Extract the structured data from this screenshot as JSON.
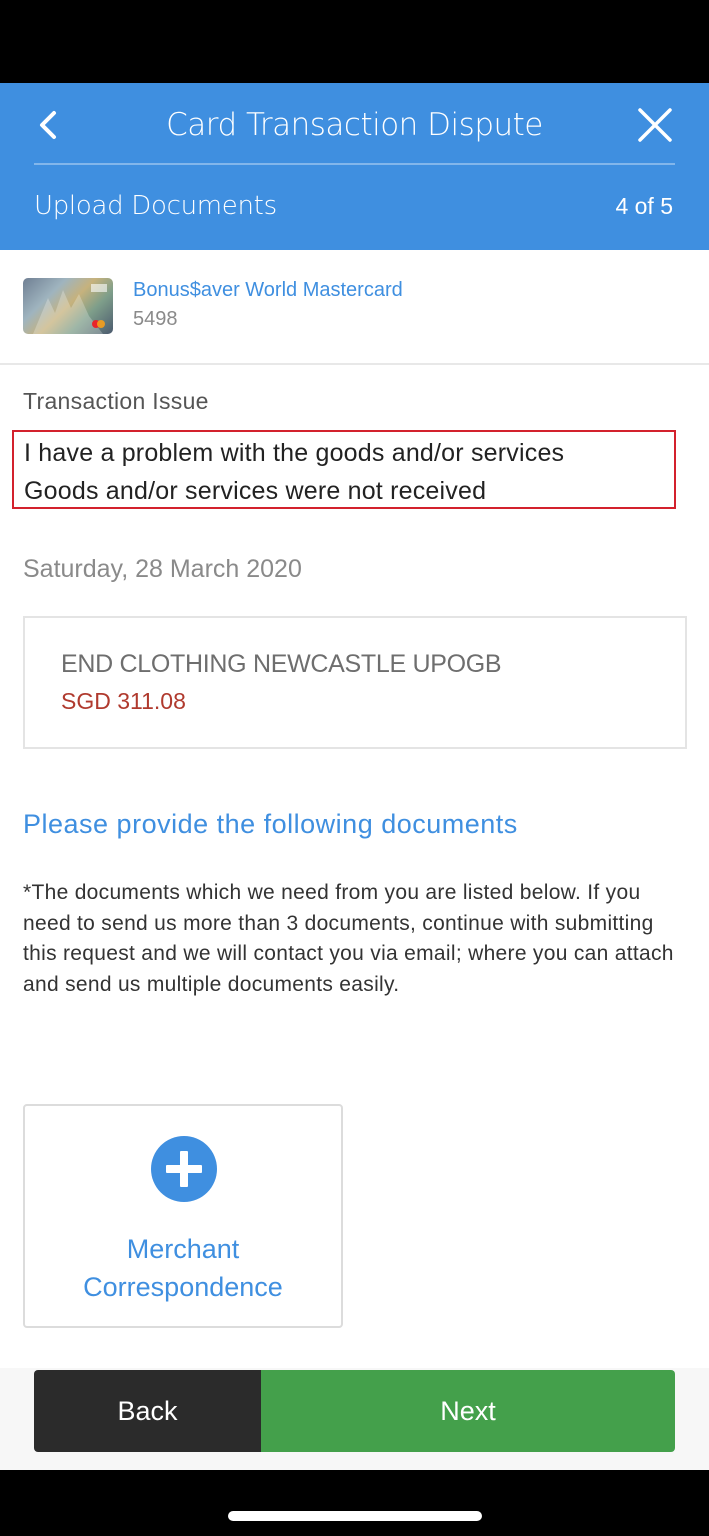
{
  "header": {
    "title": "Card Transaction Dispute",
    "step_label": "Upload Documents",
    "step_count": "4 of 5"
  },
  "card": {
    "name": "Bonus$aver World Mastercard",
    "number": "5498"
  },
  "issue": {
    "label": "Transaction Issue",
    "line1": "I have a problem with the goods and/or services",
    "line2": "Goods and/or services were not received"
  },
  "transaction": {
    "date": "Saturday, 28 March 2020",
    "merchant": "END CLOTHING NEWCASTLE UPOGB",
    "amount": "SGD 311.08"
  },
  "documents": {
    "heading": "Please provide the following documents",
    "note": "*The documents which we need from you are listed below. If you need to send us more than 3 documents, continue with submitting this request and we will contact you via email; where you can attach and send us multiple documents easily.",
    "upload_tiles": [
      {
        "line1": "Merchant",
        "line2": "Correspondence",
        "icon": "plus-circle-icon"
      }
    ]
  },
  "footer": {
    "back_label": "Back",
    "next_label": "Next"
  },
  "colors": {
    "primary_blue": "#3f8fe0",
    "next_green": "#44a04b",
    "back_dark": "#2b2b2b",
    "amount_red": "#b03a2e",
    "highlight_red": "#d3212d"
  }
}
